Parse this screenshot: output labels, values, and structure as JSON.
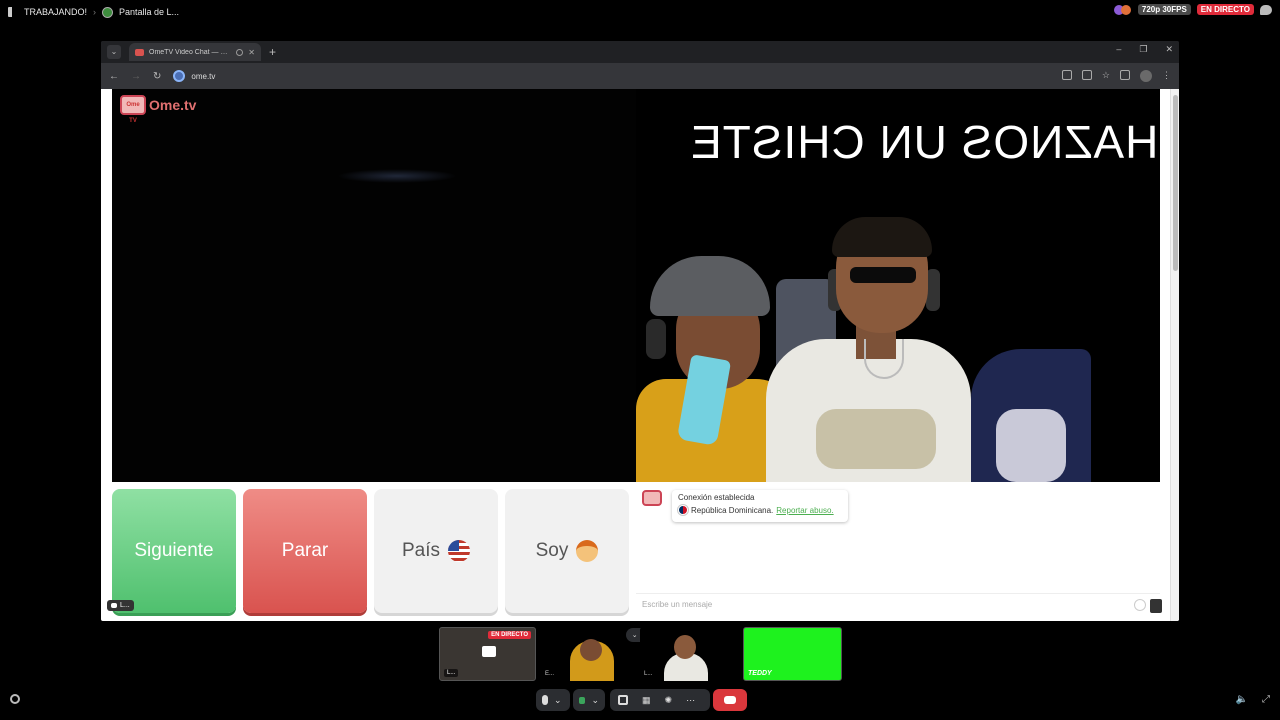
{
  "discord": {
    "activity_label": "TRABAJANDO!",
    "stream_title": "Pantalla de L...",
    "quality_badge": "720p 30FPS",
    "live_badge": "EN DIRECTO"
  },
  "browser": {
    "tab_title": "OmeTV Video Chat — Ome",
    "url": "ome.tv"
  },
  "page": {
    "logo_text": "Ome.tv",
    "logo_badge": "Ome TV",
    "overlay_text": "HAZNOS UN CHISTE",
    "buttons": {
      "next": "Siguiente",
      "stop": "Parar",
      "country": "País",
      "soy": "Soy"
    },
    "button_badge": "L...",
    "chat": {
      "status": "Conexión establecida",
      "country": "República Dominicana.",
      "report": "Reportar abuso.",
      "input_placeholder": "Escribe un mensaje"
    }
  },
  "participants": [
    {
      "label": "L...",
      "live": "EN DIRECTO"
    },
    {
      "label": "E..."
    },
    {
      "label": "L..."
    },
    {
      "label": "TEDDY"
    }
  ],
  "colors": {
    "next": "#4fc06e",
    "stop": "#d9534f",
    "live": "#e02b3a",
    "green_screen": "#1ef21e",
    "hangup": "#da373c"
  }
}
